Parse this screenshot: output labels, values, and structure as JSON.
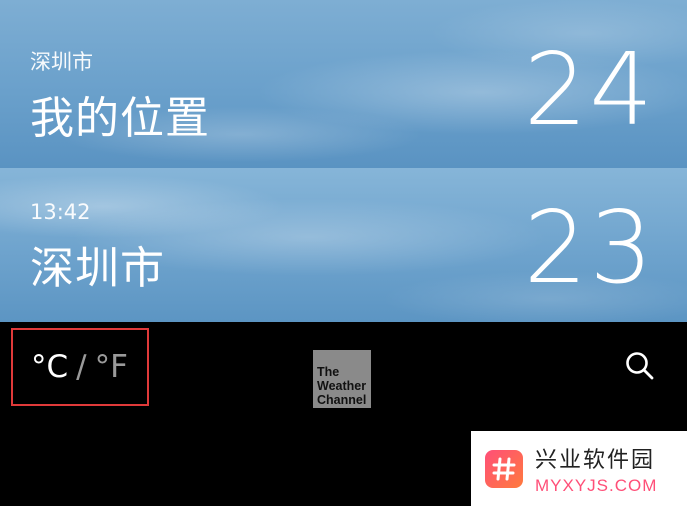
{
  "cities": [
    {
      "subtitle": "深圳市",
      "name": "我的位置",
      "temperature": "24"
    },
    {
      "subtitle": "13:42",
      "name": "深圳市",
      "temperature": "23"
    }
  ],
  "toolbar": {
    "unit_celsius": "°C",
    "unit_separator": "/",
    "unit_fahrenheit": "°F",
    "logo_lines": [
      "The",
      "Weather",
      "Channel"
    ],
    "search_icon": "search-icon"
  },
  "watermark": {
    "title": "兴业软件园",
    "url": "MYXYJS.COM"
  },
  "colors": {
    "highlight_border": "#e03a3a",
    "sky_blue": "#6aa0cb",
    "bar_background": "#000000"
  }
}
